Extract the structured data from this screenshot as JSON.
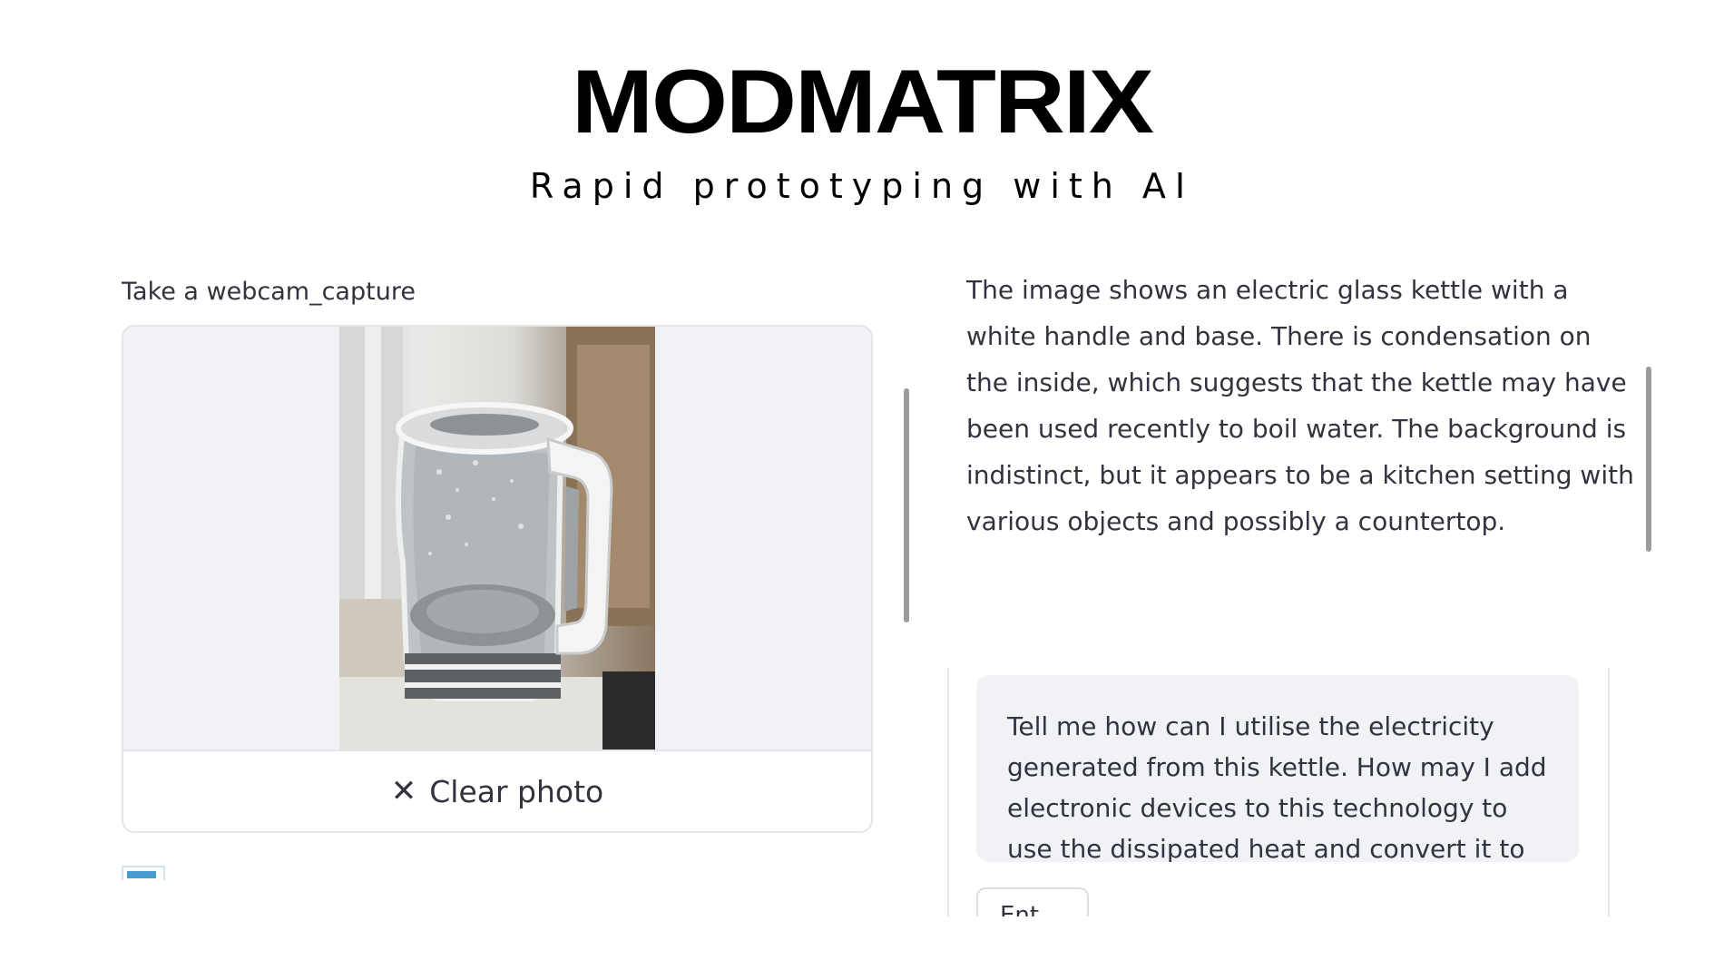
{
  "header": {
    "title": "MODMATRIX",
    "tagline": "Rapid prototyping with AI"
  },
  "camera": {
    "label": "Take a webcam_capture",
    "clear_button_label": "Clear photo",
    "clear_icon": "close-icon"
  },
  "description": {
    "text": "The image shows an electric glass kettle with a white handle and base. There is condensation on the inside, which suggests that the kettle may have been used recently to boil water. The background is indistinct, but it appears to be a kitchen setting with various objects and possibly a countertop."
  },
  "chat": {
    "prompt_text": "Tell me how can I utilise the electricity generated from this kettle. How may I add electronic devices to this technology to use the dissipated heat and convert it to",
    "button_label": "Ent"
  },
  "colors": {
    "text": "#31333f",
    "panel_bg": "#f0f2f6",
    "border": "#e3e5ea",
    "accent": "#4a9bd1"
  }
}
